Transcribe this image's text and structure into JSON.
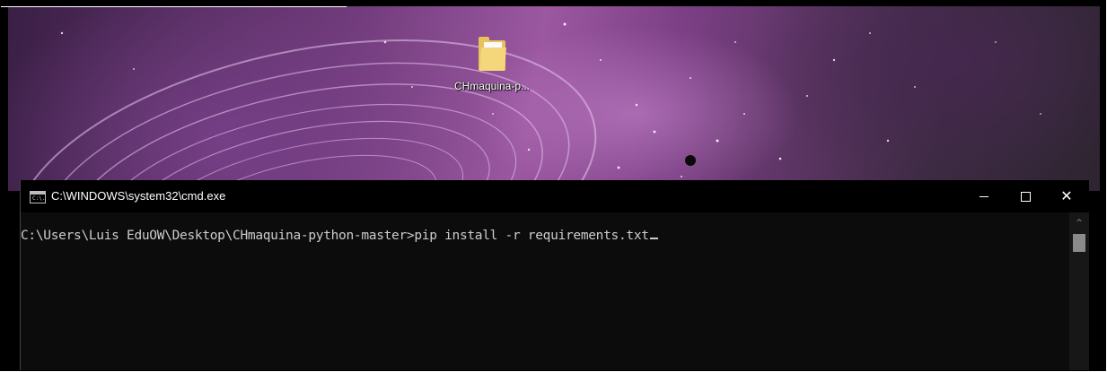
{
  "desktop": {
    "icon_label": "CHmaquina-p...",
    "icon_name": "folder-icon"
  },
  "window": {
    "title": "C:\\WINDOWS\\system32\\cmd.exe",
    "app_icon_text": "C:\\.",
    "controls": {
      "minimize": "minimize",
      "maximize": "maximize",
      "close": "✕"
    }
  },
  "console": {
    "prompt": "C:\\Users\\Luis EduOW\\Desktop\\CHmaquina-python-master>",
    "command": "pip install -r requirements.txt"
  },
  "scrollbar": {
    "up_arrow": "^"
  },
  "colors": {
    "console_bg": "#0c0c0c",
    "console_text": "#cccccc",
    "titlebar": "#000000"
  }
}
